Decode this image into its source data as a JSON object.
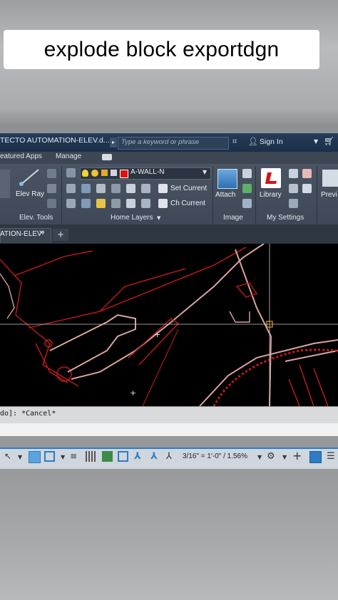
{
  "caption": "explode block exportdgn",
  "window": {
    "title": "TECTO AUTOMATION-ELEV.d...",
    "search_placeholder": "Type a keyword or phrase",
    "sign_in": "Sign In"
  },
  "ribbon_tabs": [
    "eatured Apps",
    "Manage"
  ],
  "ribbon": {
    "elev_ray": "Elev Ray",
    "elev_tools": "Elev. Tools",
    "layer_name": "A-WALL-N",
    "set_current": "Set Current",
    "ch_current": "Ch Current",
    "home_layers": "Home Layers",
    "attach": "Attach",
    "image": "Image",
    "library": "Library",
    "my_settings": "My Settings",
    "preview": "Previ"
  },
  "file_tab": "ATION-ELEV*",
  "command_line": "do]: *Cancel*",
  "statusbar": {
    "scale": "3/16\" = 1'-0\" / 1.56%"
  },
  "colors": {
    "accent": "#2e7cc4",
    "titlebar": "#1b2f47",
    "ribbon": "#444e5c",
    "canvas": "#000000",
    "drawing_red": "#c41b1b",
    "drawing_pink": "#d9a3a3",
    "layer_swatch": "#e01010"
  },
  "icons": [
    "binoculars-icon",
    "user-icon",
    "cart-icon",
    "elev-ray-icon",
    "lightbulb-icon",
    "sun-icon",
    "lock-icon",
    "attach-image-icon",
    "library-icon",
    "gear-icon",
    "plus-icon",
    "menu-icon"
  ]
}
